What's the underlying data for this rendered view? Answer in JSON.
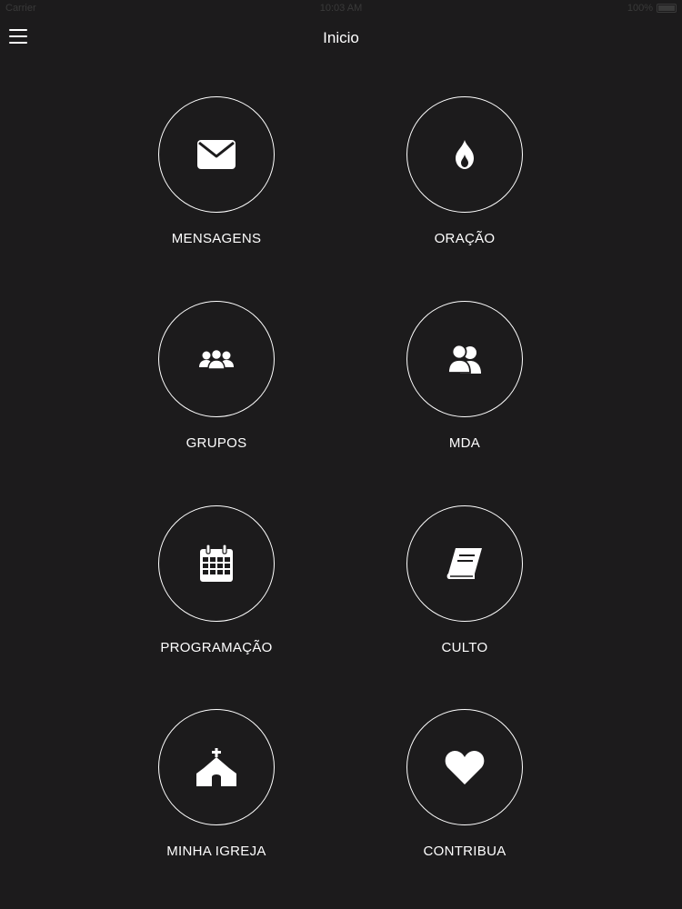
{
  "status_bar": {
    "carrier": "Carrier",
    "time": "10:03 AM",
    "battery": "100%"
  },
  "header": {
    "title": "Inicio"
  },
  "tiles": [
    {
      "label": "MENSAGENS",
      "icon": "envelope-icon"
    },
    {
      "label": "ORAÇÃO",
      "icon": "flame-icon"
    },
    {
      "label": "GRUPOS",
      "icon": "group-icon"
    },
    {
      "label": "MDA",
      "icon": "users-icon"
    },
    {
      "label": "PROGRAMAÇÃO",
      "icon": "calendar-icon"
    },
    {
      "label": "CULTO",
      "icon": "book-icon"
    },
    {
      "label": "MINHA IGREJA",
      "icon": "church-icon"
    },
    {
      "label": "CONTRIBUA",
      "icon": "heart-icon"
    }
  ],
  "colors": {
    "background": "#1c1b1c",
    "foreground": "#ffffff"
  }
}
